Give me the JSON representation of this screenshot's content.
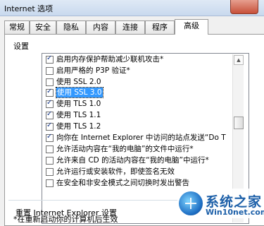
{
  "window": {
    "title": "Internet 选项"
  },
  "tabs": [
    {
      "label": "常规"
    },
    {
      "label": "安全"
    },
    {
      "label": "隐私"
    },
    {
      "label": "内容"
    },
    {
      "label": "连接"
    },
    {
      "label": "程序"
    },
    {
      "label": "高级",
      "active": true
    }
  ],
  "settings": {
    "label": "设置",
    "items": [
      {
        "text": "启用内存保护帮助减少联机攻击*",
        "checked": true
      },
      {
        "text": "启用严格的 P3P 验证*",
        "checked": false
      },
      {
        "text": "使用 SSL 2.0",
        "checked": false
      },
      {
        "text": "使用 SSL 3.0",
        "checked": true,
        "selected": true
      },
      {
        "text": "使用 TLS 1.0",
        "checked": true
      },
      {
        "text": "使用 TLS 1.1",
        "checked": true
      },
      {
        "text": "使用 TLS 1.2",
        "checked": true
      },
      {
        "text": "向你在 Internet Explorer 中访问的站点发送“Do T",
        "checked": true
      },
      {
        "text": "允许活动内容在“我的电脑”的文件中运行*",
        "checked": false
      },
      {
        "text": "允许来自 CD 的活动内容在“我的电脑”中运行*",
        "checked": false
      },
      {
        "text": "允许运行或安装软件，即使签名无效",
        "checked": false
      },
      {
        "text": "在安全和非安全模式之间切换时发出警告",
        "checked": false
      }
    ]
  },
  "restart_note": "*在重新启动你的计算机后生效",
  "reset": {
    "label": "重置 Internet Explorer 设置"
  },
  "watermark": {
    "line1": "系统之家",
    "line2": "Win10net.com"
  }
}
